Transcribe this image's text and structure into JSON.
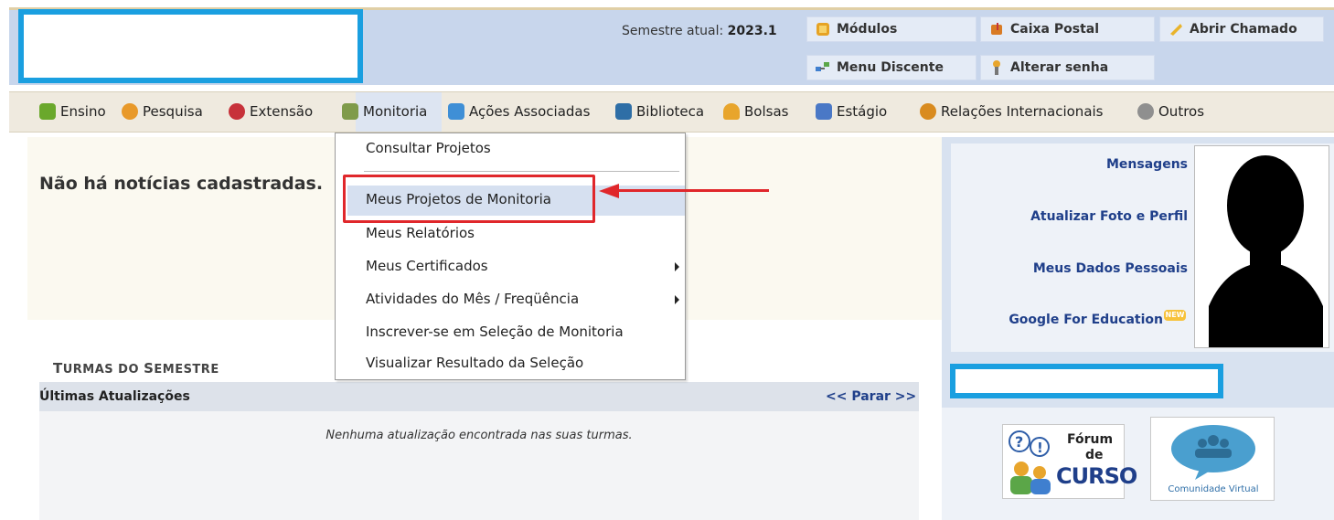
{
  "header": {
    "semester_label": "Semestre atual:",
    "semester_value": "2023.1",
    "buttons": [
      {
        "label": "Módulos",
        "icon": "modules-icon"
      },
      {
        "label": "Caixa Postal",
        "icon": "mailbox-icon"
      },
      {
        "label": "Abrir Chamado",
        "icon": "ticket-icon"
      },
      {
        "label": "Menu Discente",
        "icon": "student-menu-icon"
      },
      {
        "label": "Alterar senha",
        "icon": "password-icon"
      }
    ]
  },
  "menubar": {
    "items": [
      {
        "label": "Ensino",
        "icon": "book-icon",
        "color": "#6aa82c"
      },
      {
        "label": "Pesquisa",
        "icon": "flask-icon",
        "color": "#e8992a"
      },
      {
        "label": "Extensão",
        "icon": "heart-icon",
        "color": "#c7323a"
      },
      {
        "label": "Monitoria",
        "icon": "trophy-icon",
        "color": "#7f9b4a"
      },
      {
        "label": "Ações Associadas",
        "icon": "puzzle-icon",
        "color": "#3f8fd6"
      },
      {
        "label": "Biblioteca",
        "icon": "library-icon",
        "color": "#2e6ea6"
      },
      {
        "label": "Bolsas",
        "icon": "scholar-icon",
        "color": "#e8a52c"
      },
      {
        "label": "Estágio",
        "icon": "internship-icon",
        "color": "#4a78c6"
      },
      {
        "label": "Relações Internacionais",
        "icon": "globe-icon",
        "color": "#d98b1f"
      },
      {
        "label": "Outros",
        "icon": "other-icon",
        "color": "#8f8f8f"
      }
    ]
  },
  "news": {
    "empty_text": "Não há notícias cadastradas."
  },
  "dropdown": {
    "items": [
      {
        "label": "Consultar Projetos",
        "submenu": false
      },
      {
        "label": "Meus Projetos de Monitoria",
        "submenu": false
      },
      {
        "label": "Meus Relatórios",
        "submenu": false
      },
      {
        "label": "Meus Certificados",
        "submenu": true
      },
      {
        "label": "Atividades do Mês / Freqüência",
        "submenu": true
      },
      {
        "label": "Inscrever-se em Seleção de Monitoria",
        "submenu": false
      },
      {
        "label": "Visualizar Resultado da Seleção",
        "submenu": false
      }
    ]
  },
  "turmas": {
    "title_first": "T",
    "title_rest": "URMAS DO ",
    "title_first2": "S",
    "title_rest2": "EMESTRE"
  },
  "updates": {
    "title": "Últimas Atualizações",
    "toggle": "<< Parar >>",
    "empty_text": "Nenhuma atualização encontrada nas suas turmas."
  },
  "profile": {
    "links": [
      "Mensagens",
      "Atualizar Foto e Perfil",
      "Meus Dados Pessoais",
      "Google For Education"
    ],
    "new_badge": "NEW"
  },
  "widgets": {
    "forum": {
      "line1": "Fórum",
      "line2": "de",
      "line3": "CURSO"
    },
    "comunidade": {
      "label": "Comunidade Virtual"
    }
  },
  "colors": {
    "highlight_box": "#e0272b",
    "redaction_box": "#1a9fe0",
    "link": "#1f3f8a"
  }
}
